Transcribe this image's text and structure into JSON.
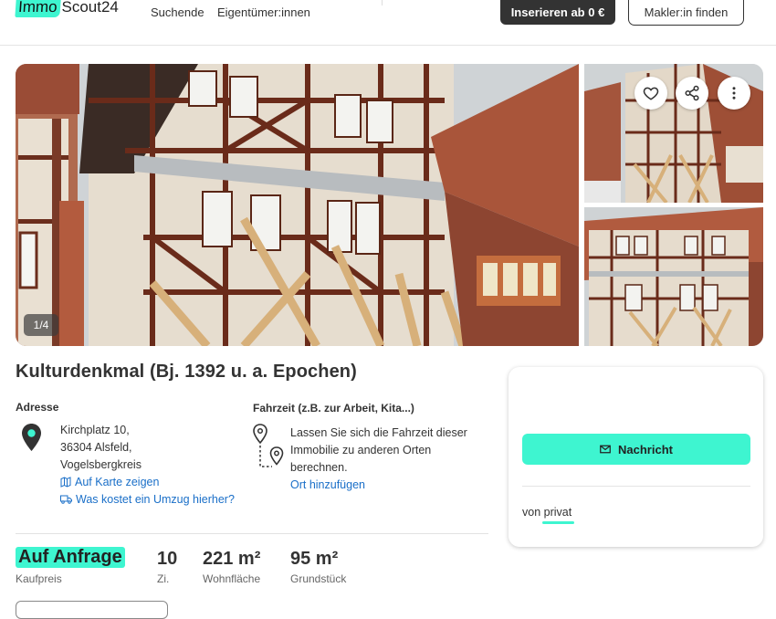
{
  "header": {
    "logo_part1": "Immo",
    "logo_part2": "Scout24",
    "nav": [
      "Suchende",
      "Eigentümer:innen"
    ],
    "insert_button": "Inserieren ab 0 €",
    "agent_button": "Makler:in finden"
  },
  "gallery": {
    "counter": "1/4",
    "actions": [
      "heart-icon",
      "share-icon",
      "more-icon"
    ]
  },
  "listing": {
    "title": "Kulturdenkmal (Bj. 1392 u. a. Epochen)",
    "address_label": "Adresse",
    "address_lines": [
      "Kirchplatz 10,",
      "36304 Alsfeld,",
      "Vogelsbergkreis"
    ],
    "map_link": "Auf Karte zeigen",
    "moving_link": "Was kostet ein Umzug hierher?",
    "commute_label": "Fahrzeit (z.B. zur Arbeit, Kita...)",
    "commute_text": [
      "Lassen Sie sich die Fahrzeit dieser",
      "Immobilie zu anderen Orten",
      "berechnen."
    ],
    "commute_link": "Ort hinzufügen"
  },
  "contact": {
    "message_button": "Nachricht",
    "from_prefix": "von",
    "from_value": "privat"
  },
  "key_facts": {
    "price_value": "Auf Anfrage",
    "price_label": "Kaufpreis",
    "rooms_value": "10",
    "rooms_label": "Zi.",
    "living_value": "221 m²",
    "living_label": "Wohnfläche",
    "plot_value": "95 m²",
    "plot_label": "Grundstück"
  },
  "colors": {
    "accent": "#3ef5d0",
    "link": "#1a6fc8",
    "dark_button": "#333333"
  }
}
